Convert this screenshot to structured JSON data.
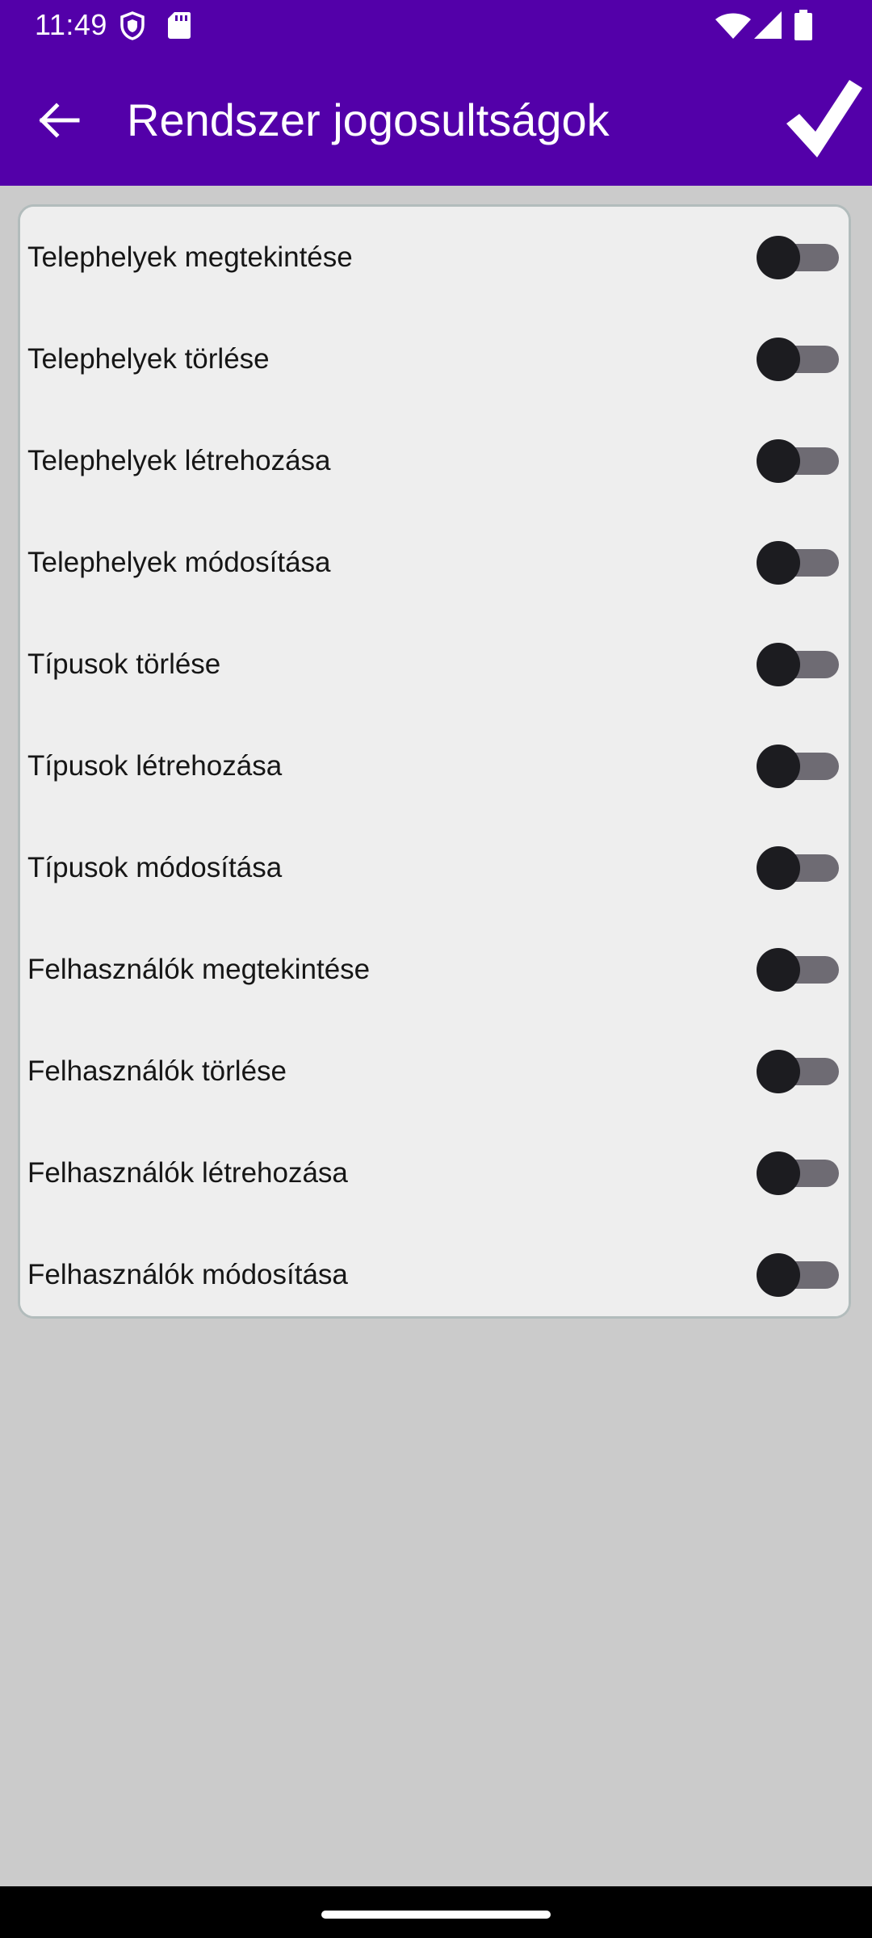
{
  "status_bar": {
    "time": "11:49",
    "left_icons": [
      "shield-icon",
      "sd-card-icon"
    ],
    "right_icons": [
      "wifi-icon",
      "cell-signal-icon",
      "battery-icon"
    ]
  },
  "app_bar": {
    "title": "Rendszer jogosultságok",
    "back_icon": "arrow-back-icon",
    "confirm_icon": "checkmark-icon",
    "background_color": "#5300a9"
  },
  "permissions": [
    {
      "label": "Telephelyek megtekintése",
      "enabled": false
    },
    {
      "label": "Telephelyek törlése",
      "enabled": false
    },
    {
      "label": "Telephelyek létrehozása",
      "enabled": false
    },
    {
      "label": "Telephelyek módosítása",
      "enabled": false
    },
    {
      "label": "Típusok törlése",
      "enabled": false
    },
    {
      "label": "Típusok létrehozása",
      "enabled": false
    },
    {
      "label": "Típusok módosítása",
      "enabled": false
    },
    {
      "label": "Felhasználók megtekintése",
      "enabled": false
    },
    {
      "label": "Felhasználók törlése",
      "enabled": false
    },
    {
      "label": "Felhasználók létrehozása",
      "enabled": false
    },
    {
      "label": "Felhasználók módosítása",
      "enabled": false
    }
  ],
  "colors": {
    "page_background": "#cbcbcb",
    "row_background": "#eeeeee",
    "divider": "#b2bcbc",
    "switch_track_off": "#6e6b73",
    "switch_thumb_off": "#1c1c20"
  }
}
